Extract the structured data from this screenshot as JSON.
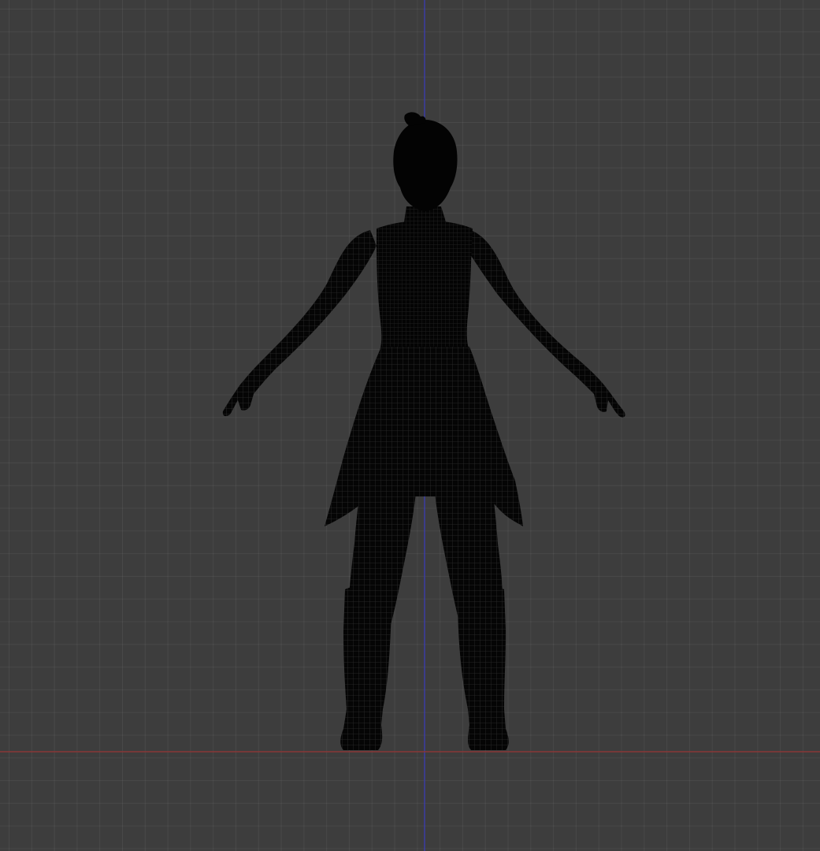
{
  "viewport": {
    "mode": "orthographic-front-view",
    "shading": "wireframe",
    "background_color": "#3d3d3d",
    "grid_color": "#474747",
    "axis_z_color": "#3b3dab",
    "axis_x_color": "#8a3636",
    "mesh_color": "#000000",
    "wire_color": "#2a2a2a"
  },
  "scene_object": {
    "icon": "character-wireframe-mesh",
    "pose": "A-pose",
    "parts": [
      "hair",
      "head",
      "neck",
      "torso",
      "arms",
      "hands",
      "skirt",
      "legs",
      "boots"
    ]
  }
}
